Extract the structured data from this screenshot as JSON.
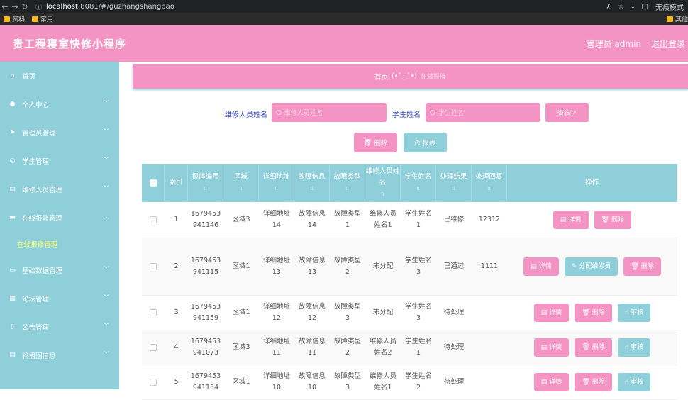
{
  "browser": {
    "url_host": "localhost",
    "url_rest": ":8081/#/guzhangshangbao",
    "incognito_label": "无痕模式",
    "bookmarks": [
      "资料",
      "常用"
    ],
    "bookmarks_right": "其他"
  },
  "header": {
    "title": "贵工程寝室快修小程序",
    "user_label": "管理员 admin",
    "logout_label": "退出登录"
  },
  "sidebar": {
    "items": [
      {
        "label": "首页",
        "icon": "home-icon",
        "has_chevron": false
      },
      {
        "label": "个人中心",
        "icon": "user-icon",
        "has_chevron": true
      },
      {
        "label": "管理员管理",
        "icon": "send-icon",
        "has_chevron": true
      },
      {
        "label": "学生管理",
        "icon": "compass-icon",
        "has_chevron": true
      },
      {
        "label": "维修人员管理",
        "icon": "clipboard-icon",
        "has_chevron": true
      },
      {
        "label": "在线报修管理",
        "icon": "chat-icon",
        "has_chevron": true,
        "expanded": true
      },
      {
        "label": "基础数据管理",
        "icon": "monitor-icon",
        "has_chevron": true
      },
      {
        "label": "论坛管理",
        "icon": "grid-icon",
        "has_chevron": true
      },
      {
        "label": "公告管理",
        "icon": "mobile-icon",
        "has_chevron": true
      },
      {
        "label": "轮播图信息",
        "icon": "clipboard-icon",
        "has_chevron": true
      }
    ],
    "submenu_active": "在线报修管理"
  },
  "breadcrumb": {
    "home": "首页",
    "emoticon": "(•ˇ‿ˇ•)",
    "current": "在线报修"
  },
  "search": {
    "repair_label": "维修人员姓名",
    "repair_placeholder": "维修人员姓名",
    "student_label": "学生姓名",
    "student_placeholder": "学生姓名",
    "query_button": "查询"
  },
  "actions": {
    "delete_label": "删除",
    "report_label": "报表"
  },
  "table": {
    "headers": [
      "索引",
      "报修编号",
      "区域",
      "详细地址",
      "故障信息",
      "故障类型",
      "维修人员姓名",
      "学生姓名",
      "处理结果",
      "处理回复",
      "操作"
    ],
    "rows": [
      {
        "index": "1",
        "no": "1679453941146",
        "area": "区域3",
        "addr": "详细地址14",
        "info": "故障信息14",
        "type": "故障类型1",
        "repairer": "维修人员姓名1",
        "student": "学生姓名1",
        "result": "已维修",
        "reply": "12312",
        "ops": [
          "详情",
          "删除"
        ]
      },
      {
        "index": "2",
        "no": "1679453941115",
        "area": "区域1",
        "addr": "详细地址13",
        "info": "故障信息13",
        "type": "故障类型2",
        "repairer": "未分配",
        "student": "学生姓名3",
        "result": "已通过",
        "reply": "1111",
        "ops": [
          "详情",
          "分配维修员",
          "删除"
        ]
      },
      {
        "index": "3",
        "no": "1679453941159",
        "area": "区域1",
        "addr": "详细地址12",
        "info": "故障信息12",
        "type": "故障类型3",
        "repairer": "未分配",
        "student": "学生姓名3",
        "result": "待处理",
        "reply": "",
        "ops": [
          "详情",
          "删除",
          "审核"
        ]
      },
      {
        "index": "4",
        "no": "1679453941073",
        "area": "区域3",
        "addr": "详细地址11",
        "info": "故障信息11",
        "type": "故障类型2",
        "repairer": "维修人员姓名2",
        "student": "学生姓名1",
        "result": "待处理",
        "reply": "",
        "ops": [
          "详情",
          "删除",
          "审核"
        ]
      },
      {
        "index": "5",
        "no": "1679453941134",
        "area": "区域1",
        "addr": "详细地址10",
        "info": "故障信息10",
        "type": "故障类型3",
        "repairer": "维修人员姓名1",
        "student": "学生姓名2",
        "result": "待处理",
        "reply": "",
        "ops": [
          "详情",
          "删除",
          "审核"
        ]
      }
    ]
  },
  "colors": {
    "pink": "#f394c4",
    "teal": "#8ecfd9",
    "submenu_active": "#ffff6b",
    "search_label": "#3c49c8"
  }
}
